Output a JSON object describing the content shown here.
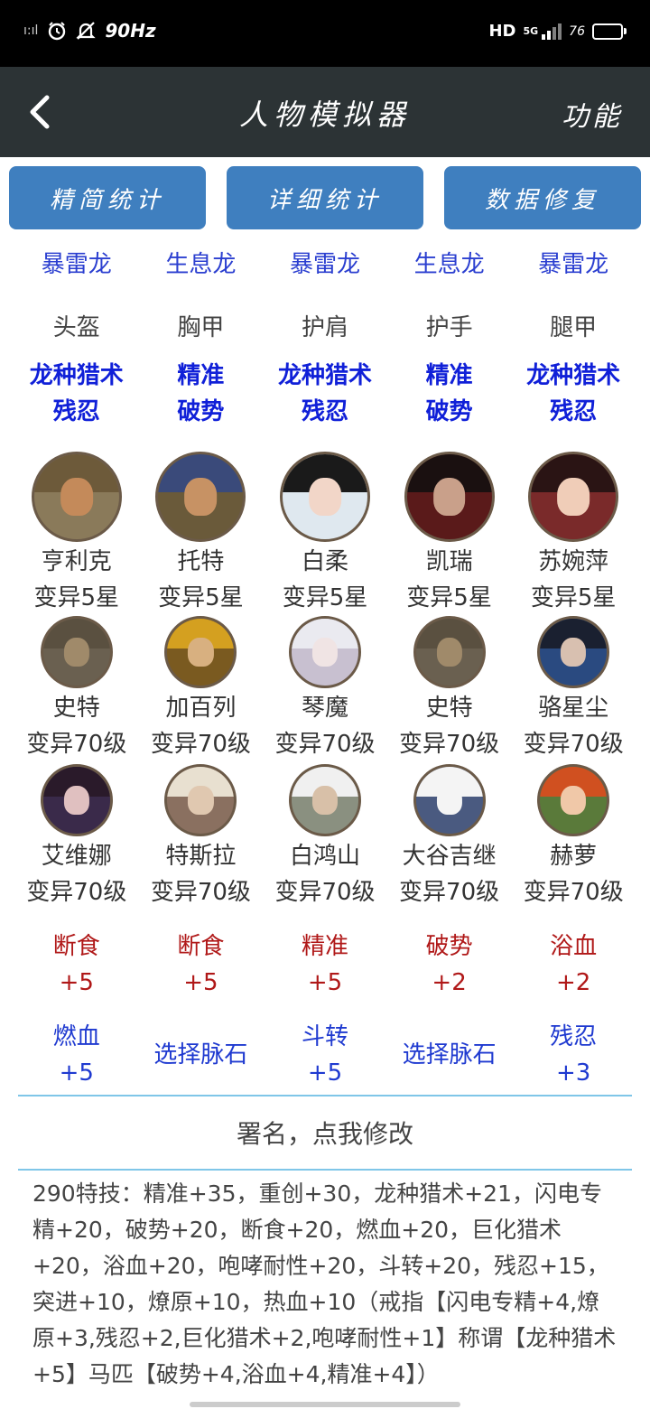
{
  "status_bar": {
    "signal_left": "ı:ıl",
    "refresh_rate": "90Hz",
    "hd": "HD",
    "network": "5G",
    "battery_text": "76",
    "battery_level": 0.76
  },
  "header": {
    "title": "人物模拟器",
    "function_label": "功能"
  },
  "tabs": [
    {
      "label": "精简统计"
    },
    {
      "label": "详细统计"
    },
    {
      "label": "数据修复"
    }
  ],
  "dragons": [
    "暴雷龙",
    "生息龙",
    "暴雷龙",
    "生息龙",
    "暴雷龙"
  ],
  "gear": [
    "头盔",
    "胸甲",
    "护肩",
    "护手",
    "腿甲"
  ],
  "gear_skills": [
    {
      "line1": "龙种猎术",
      "line2": "残忍"
    },
    {
      "line1": "精准",
      "line2": "破势"
    },
    {
      "line1": "龙种猎术",
      "line2": "残忍"
    },
    {
      "line1": "精准",
      "line2": "破势"
    },
    {
      "line1": "龙种猎术",
      "line2": "残忍"
    }
  ],
  "heroes_main": [
    {
      "name": "亨利克",
      "level": "变异5星",
      "skin": "#c48a5a",
      "hair": "#6d5a3a",
      "bg": "#8a7a5a"
    },
    {
      "name": "托特",
      "level": "变异5星",
      "skin": "#c79264",
      "hair": "#3a4a7a",
      "bg": "#6a5a3a"
    },
    {
      "name": "白柔",
      "level": "变异5星",
      "skin": "#f2d6c8",
      "hair": "#1a1a1a",
      "bg": "#dfe8ef"
    },
    {
      "name": "凯瑞",
      "level": "变异5星",
      "skin": "#c9a08a",
      "hair": "#1a1010",
      "bg": "#5a1a1a"
    },
    {
      "name": "苏婉萍",
      "level": "变异5星",
      "skin": "#f0cdb8",
      "hair": "#2a1414",
      "bg": "#7a2a2a"
    }
  ],
  "heroes_row2": [
    {
      "name": "史特",
      "level": "变异70级",
      "skin": "#a08a6a",
      "hair": "#5a5040",
      "bg": "#6a6050"
    },
    {
      "name": "加百列",
      "level": "变异70级",
      "skin": "#d8b080",
      "hair": "#d4a020",
      "bg": "#7a5a20"
    },
    {
      "name": "琴魔",
      "level": "变异70级",
      "skin": "#f0e4e4",
      "hair": "#eaeaf0",
      "bg": "#c8c0d0"
    },
    {
      "name": "史特",
      "level": "变异70级",
      "skin": "#a08a6a",
      "hair": "#5a5040",
      "bg": "#6a6050"
    },
    {
      "name": "骆星尘",
      "level": "变异70级",
      "skin": "#d8c0b0",
      "hair": "#1a2030",
      "bg": "#2a4a80"
    }
  ],
  "heroes_row3": [
    {
      "name": "艾维娜",
      "level": "变异70级",
      "skin": "#e0c0c0",
      "hair": "#2a1a2a",
      "bg": "#3a2a4a"
    },
    {
      "name": "特斯拉",
      "level": "变异70级",
      "skin": "#e0c8b0",
      "hair": "#e8e0d0",
      "bg": "#8a7060"
    },
    {
      "name": "白鸿山",
      "level": "变异70级",
      "skin": "#d8c0a8",
      "hair": "#f0f0f0",
      "bg": "#8a9080"
    },
    {
      "name": "大谷吉继",
      "level": "变异70级",
      "skin": "#f4f4f4",
      "hair": "#f4f4f4",
      "bg": "#4a5a80"
    },
    {
      "name": "赫萝",
      "level": "变异70级",
      "skin": "#f0c8a8",
      "hair": "#d05020",
      "bg": "#5a7a3a"
    }
  ],
  "veinstones_row1": [
    {
      "name": "断食",
      "value": "+5"
    },
    {
      "name": "断食",
      "value": "+5"
    },
    {
      "name": "精准",
      "value": "+5"
    },
    {
      "name": "破势",
      "value": "+2"
    },
    {
      "name": "浴血",
      "value": "+2"
    }
  ],
  "veinstones_row2": [
    {
      "name": "燃血",
      "value": "+5",
      "empty": false
    },
    {
      "name": "选择脉石",
      "value": "",
      "empty": true
    },
    {
      "name": "斗转",
      "value": "+5",
      "empty": false
    },
    {
      "name": "选择脉石",
      "value": "",
      "empty": true
    },
    {
      "name": "残忍",
      "value": "+3",
      "empty": false
    }
  ],
  "signature": "署名，点我修改",
  "summary": "290特技：精准+35，重创+30，龙种猎术+21，闪电专精+20，破势+20，断食+20，燃血+20，巨化猎术+20，浴血+20，咆哮耐性+20，斗转+20，残忍+15，突进+10，燎原+10，热血+10（戒指【闪电专精+4,燎原+3,残忍+2,巨化猎术+2,咆哮耐性+1】称谓【龙种猎术+5】马匹【破势+4,浴血+4,精准+4】）"
}
